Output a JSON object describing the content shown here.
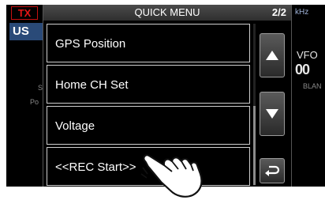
{
  "status": {
    "tx": "TX",
    "mode": "US",
    "s_label": "S",
    "po_label": "Po"
  },
  "freq": {
    "unit": "kHz",
    "vfo": "VFO",
    "digits": "00",
    "blank": "BLAN"
  },
  "menu": {
    "title": "QUICK MENU",
    "page": "2/2",
    "items": [
      {
        "label": "GPS Position"
      },
      {
        "label": "Home CH Set"
      },
      {
        "label": "Voltage"
      },
      {
        "label": "<<REC Start>>"
      }
    ]
  },
  "icons": {
    "up": "arrow-up-icon",
    "down": "arrow-down-icon",
    "back": "return-icon",
    "touch": "pointing-hand-icon"
  }
}
